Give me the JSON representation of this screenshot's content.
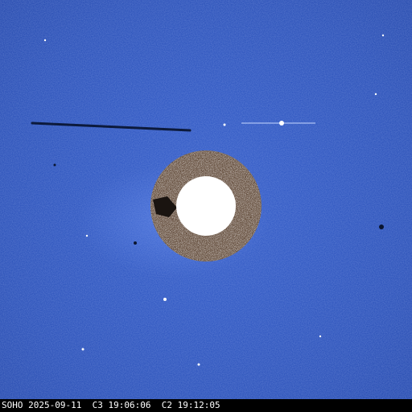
{
  "footer": {
    "observatory": "SOHO",
    "date": "2025-09-11",
    "c3_label": "C3",
    "c3_time": "19:06:06",
    "c2_label": "C2",
    "c2_time": "19:12:05"
  },
  "colors": {
    "background": "#2650bf",
    "occulter_disk": "#ffffff",
    "inner_ring": "#5a4230",
    "footer_bg": "#000000",
    "footer_text": "#ffffff"
  }
}
